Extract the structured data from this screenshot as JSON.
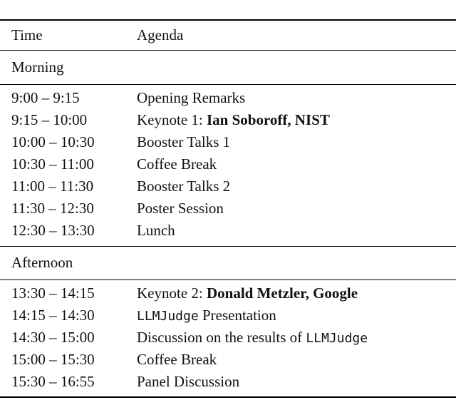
{
  "table": {
    "headers": {
      "time": "Time",
      "agenda": "Agenda"
    },
    "sections": [
      {
        "label": "Morning",
        "rows": [
          {
            "time": "9:00 – 9:15",
            "parts": [
              {
                "text": "Opening Remarks",
                "style": "normal"
              }
            ]
          },
          {
            "time": "9:15 – 10:00",
            "parts": [
              {
                "text": "Keynote 1: ",
                "style": "normal"
              },
              {
                "text": "Ian Soboroff, NIST",
                "style": "bold"
              }
            ]
          },
          {
            "time": "10:00 – 10:30",
            "parts": [
              {
                "text": "Booster Talks 1",
                "style": "normal"
              }
            ]
          },
          {
            "time": "10:30 – 11:00",
            "parts": [
              {
                "text": "Coffee Break",
                "style": "normal"
              }
            ]
          },
          {
            "time": "11:00 – 11:30",
            "parts": [
              {
                "text": "Booster Talks 2",
                "style": "normal"
              }
            ]
          },
          {
            "time": "11:30 – 12:30",
            "parts": [
              {
                "text": "Poster Session",
                "style": "normal"
              }
            ]
          },
          {
            "time": "12:30 – 13:30",
            "parts": [
              {
                "text": "Lunch",
                "style": "normal"
              }
            ]
          }
        ]
      },
      {
        "label": "Afternoon",
        "rows": [
          {
            "time": "13:30 – 14:15",
            "parts": [
              {
                "text": "Keynote 2: ",
                "style": "normal"
              },
              {
                "text": "Donald Metzler, Google",
                "style": "bold"
              }
            ]
          },
          {
            "time": "14:15 – 14:30",
            "parts": [
              {
                "text": "LLMJudge",
                "style": "mono"
              },
              {
                "text": " Presentation",
                "style": "normal"
              }
            ]
          },
          {
            "time": "14:30 – 15:00",
            "parts": [
              {
                "text": "Discussion on the results of ",
                "style": "normal"
              },
              {
                "text": "LLMJudge",
                "style": "mono"
              }
            ]
          },
          {
            "time": "15:00 – 15:30",
            "parts": [
              {
                "text": "Coffee Break",
                "style": "normal"
              }
            ]
          },
          {
            "time": "15:30 – 16:55",
            "parts": [
              {
                "text": "Panel Discussion",
                "style": "normal"
              }
            ]
          }
        ]
      }
    ]
  }
}
